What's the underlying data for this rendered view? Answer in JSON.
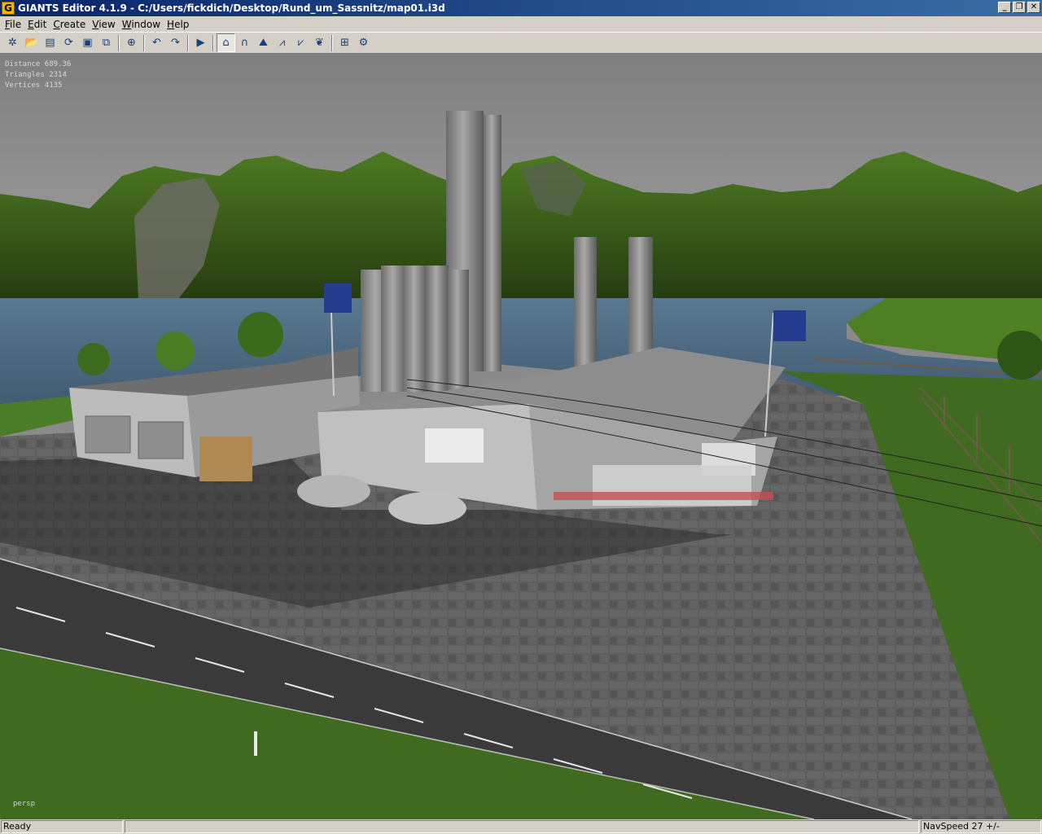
{
  "window": {
    "title": "GIANTS Editor 4.1.9 - C:/Users/fickdich/Desktop/Rund_um_Sassnitz/map01.i3d",
    "app_icon_glyph": "G",
    "controls": [
      {
        "name": "minimize-button",
        "glyph": "_"
      },
      {
        "name": "restore-button",
        "glyph": "❐"
      },
      {
        "name": "close-button",
        "glyph": "✕"
      }
    ]
  },
  "menu": [
    "File",
    "Edit",
    "Create",
    "View",
    "Window",
    "Help"
  ],
  "toolbar": {
    "groups": [
      [
        {
          "icon": "new-scene-icon",
          "glyph": "✲"
        },
        {
          "icon": "open-icon",
          "glyph": "📂"
        },
        {
          "icon": "properties-icon",
          "glyph": "▤"
        },
        {
          "icon": "reload-icon",
          "glyph": "⟳"
        },
        {
          "icon": "save-icon",
          "glyph": "▣"
        },
        {
          "icon": "save-as-icon",
          "glyph": "⧉"
        }
      ],
      [
        {
          "icon": "import-icon",
          "glyph": "⊕"
        }
      ],
      [
        {
          "icon": "undo-icon",
          "glyph": "↶"
        },
        {
          "icon": "redo-icon",
          "glyph": "↷"
        }
      ],
      [
        {
          "icon": "play-icon",
          "glyph": "▶"
        }
      ],
      [
        {
          "icon": "object-mode-icon",
          "glyph": "⌂",
          "active": true
        },
        {
          "icon": "magnet-icon",
          "glyph": "∩"
        },
        {
          "icon": "terrain-sculpt-icon",
          "glyph": "⛰"
        },
        {
          "icon": "terrain-paint-icon",
          "glyph": "⩘"
        },
        {
          "icon": "terrain-detail-icon",
          "glyph": "⩗"
        },
        {
          "icon": "foliage-icon",
          "glyph": "❦"
        }
      ],
      [
        {
          "icon": "grid-icon",
          "glyph": "⊞"
        },
        {
          "icon": "settings-icon",
          "glyph": "⚙"
        }
      ]
    ]
  },
  "viewport": {
    "stats": [
      {
        "label": "Distance",
        "value": "689.36"
      },
      {
        "label": "Triangles",
        "value": "2314"
      },
      {
        "label": "Vertices",
        "value": "4135"
      }
    ],
    "camera_label": "persp",
    "colors": {
      "sky": "#8c8c8c",
      "hills": "#3d5e1c",
      "water": "#4f6b86",
      "pavement": "#5b5b5b",
      "road": "#3a3a3a",
      "grass": "#3f6a1f",
      "building": "#bdbdbd"
    }
  },
  "status": {
    "left": "Ready",
    "right": "NavSpeed 27 +/-"
  }
}
